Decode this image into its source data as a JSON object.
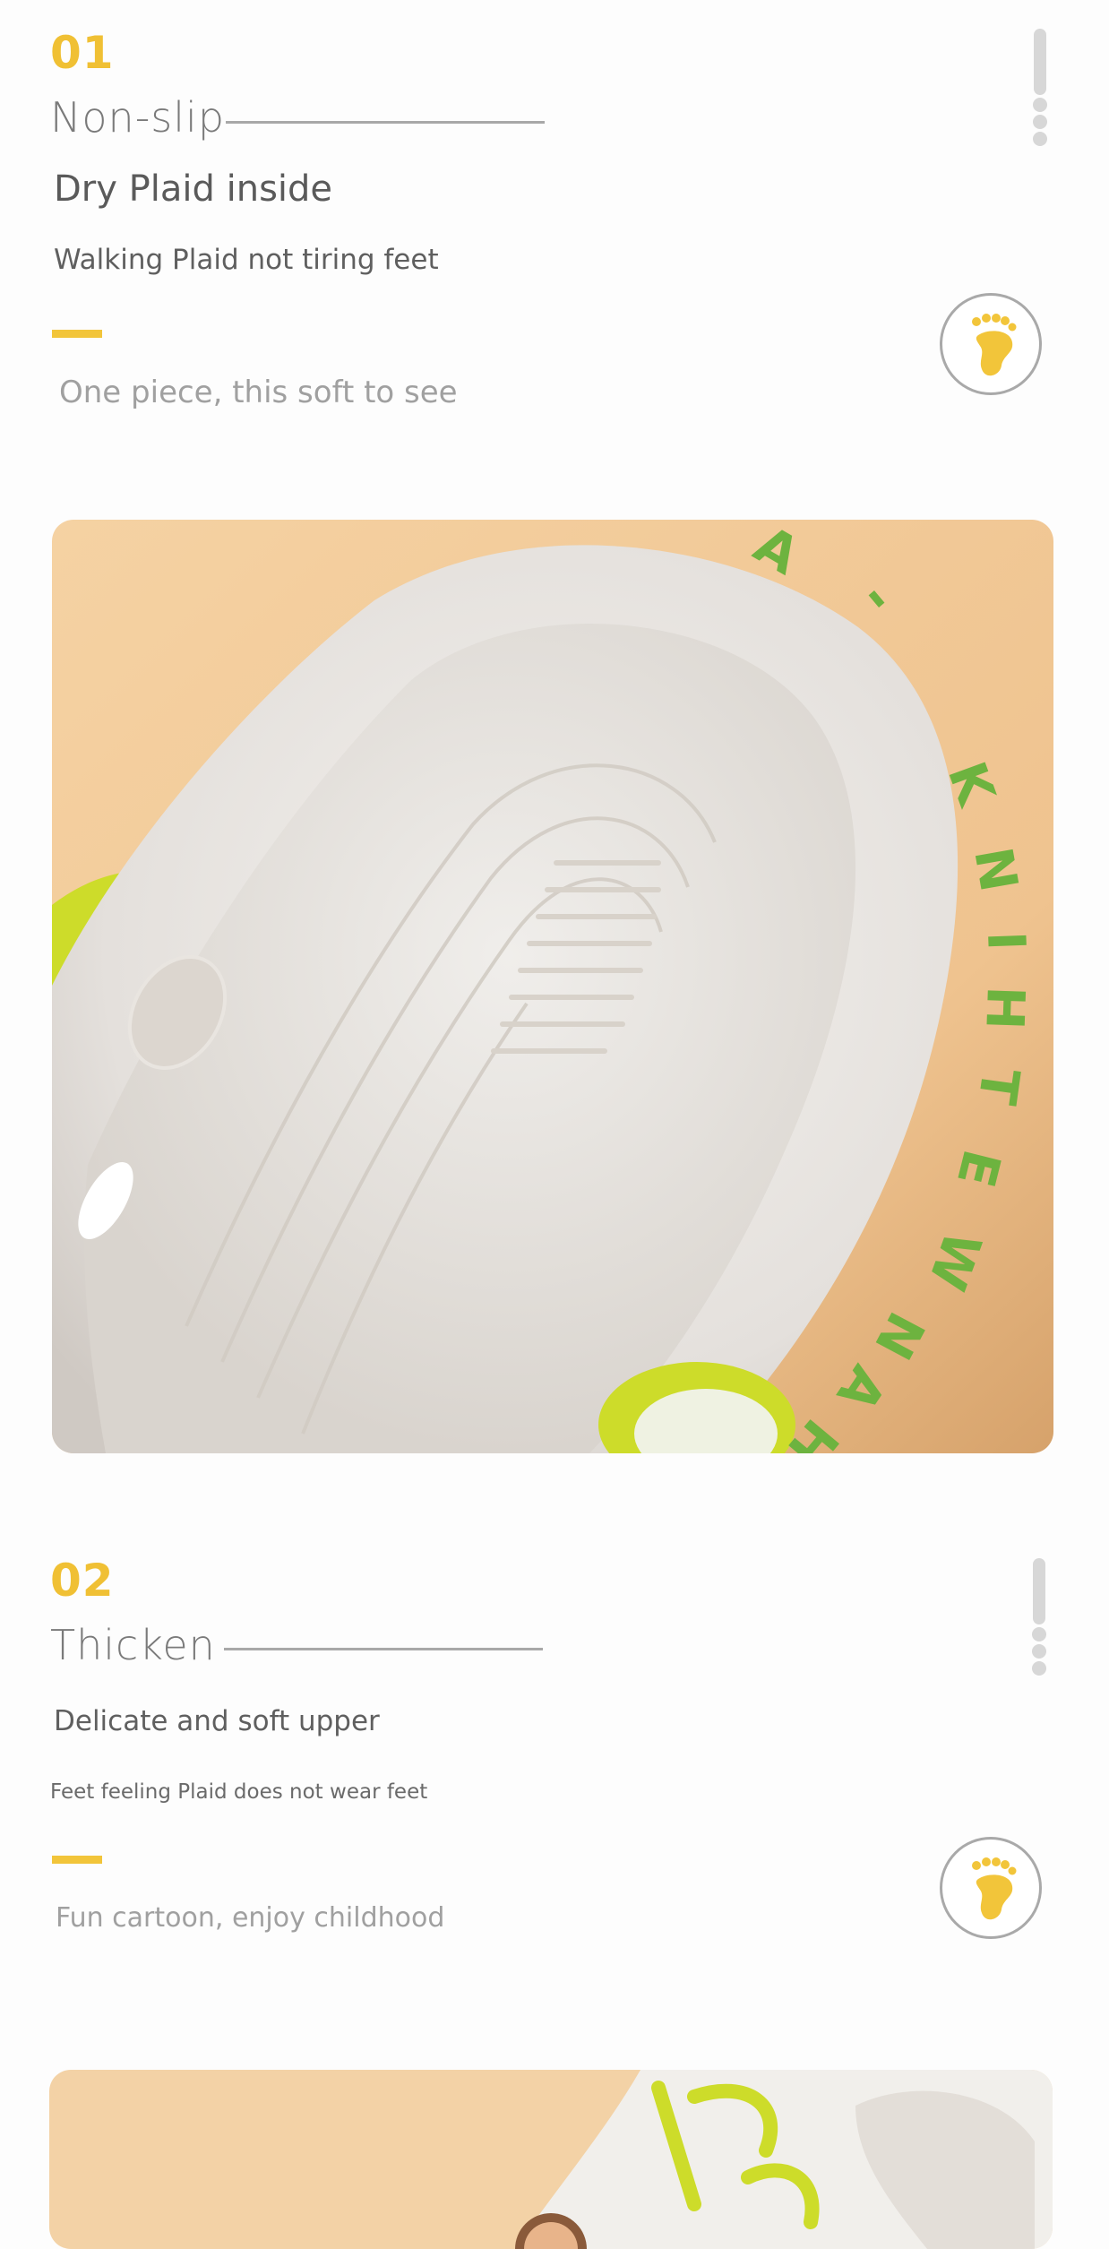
{
  "sections": [
    {
      "number": "01",
      "label": "Non-slip",
      "headline": "Dry Plaid inside",
      "subline": "Walking Plaid not tiring feet",
      "tagline": "One piece, this soft to see"
    },
    {
      "number": "02",
      "label": "Thicken",
      "headline": "Delicate and soft upper",
      "subline": "Feet feeling Plaid does not wear feet",
      "tagline": "Fun cartoon, enjoy childhood"
    }
  ],
  "photo1": {
    "rim_text": "HAN WE THINK -A DO"
  },
  "colors": {
    "accent": "#f2c53a",
    "number": "#f0c034",
    "background_peach": "#f3cfa0",
    "logo_green": "#6db33f",
    "trim_yellow_green": "#cddc2a"
  },
  "icons": {
    "badge": "foot-icon",
    "scroll": "scroll-indicator-icon"
  }
}
